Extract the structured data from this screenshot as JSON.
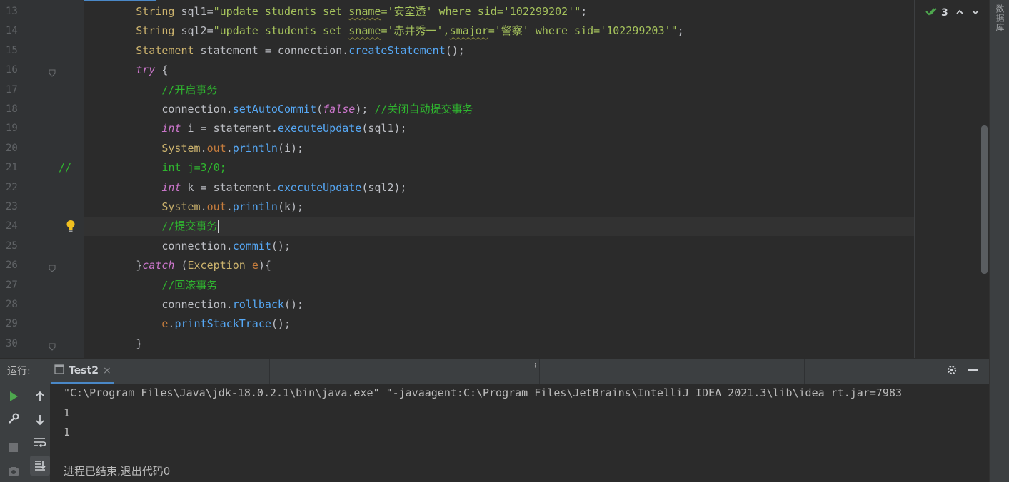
{
  "editor": {
    "lines": [
      {
        "n": "13",
        "tokens": [
          {
            "t": "        ",
            "c": "c-plain"
          },
          {
            "t": "String",
            "c": "c-type"
          },
          {
            "t": " sql1=",
            "c": "c-plain"
          },
          {
            "t": "\"update students set ",
            "c": "c-str"
          },
          {
            "t": "sname",
            "c": "c-str squiggle"
          },
          {
            "t": "='安室透' where sid='102299202'\"",
            "c": "c-str"
          },
          {
            "t": ";",
            "c": "c-plain"
          }
        ]
      },
      {
        "n": "14",
        "tokens": [
          {
            "t": "        ",
            "c": "c-plain"
          },
          {
            "t": "String",
            "c": "c-type"
          },
          {
            "t": " sql2=",
            "c": "c-plain"
          },
          {
            "t": "\"update students set ",
            "c": "c-str"
          },
          {
            "t": "sname",
            "c": "c-str squiggle"
          },
          {
            "t": "='赤井秀一',",
            "c": "c-str"
          },
          {
            "t": "smajor",
            "c": "c-str squiggle"
          },
          {
            "t": "='警察' where sid='102299203'\"",
            "c": "c-str"
          },
          {
            "t": ";",
            "c": "c-plain"
          }
        ]
      },
      {
        "n": "15",
        "tokens": [
          {
            "t": "        ",
            "c": "c-plain"
          },
          {
            "t": "Statement",
            "c": "c-type"
          },
          {
            "t": " statement = connection.",
            "c": "c-plain"
          },
          {
            "t": "createStatement",
            "c": "c-meth"
          },
          {
            "t": "();",
            "c": "c-plain"
          }
        ]
      },
      {
        "n": "16",
        "fold": true,
        "tokens": [
          {
            "t": "        ",
            "c": "c-plain"
          },
          {
            "t": "try",
            "c": "c-kw"
          },
          {
            "t": " {",
            "c": "c-plain"
          }
        ]
      },
      {
        "n": "17",
        "tokens": [
          {
            "t": "            ",
            "c": "c-plain"
          },
          {
            "t": "//开启事务",
            "c": "c-cm"
          }
        ]
      },
      {
        "n": "18",
        "tokens": [
          {
            "t": "            connection.",
            "c": "c-plain"
          },
          {
            "t": "setAutoCommit",
            "c": "c-meth"
          },
          {
            "t": "(",
            "c": "c-plain"
          },
          {
            "t": "false",
            "c": "c-kw"
          },
          {
            "t": "); ",
            "c": "c-plain"
          },
          {
            "t": "//关闭自动提交事务",
            "c": "c-cm"
          }
        ]
      },
      {
        "n": "19",
        "tokens": [
          {
            "t": "            ",
            "c": "c-plain"
          },
          {
            "t": "int",
            "c": "c-kw"
          },
          {
            "t": " i = statement.",
            "c": "c-plain"
          },
          {
            "t": "executeUpdate",
            "c": "c-meth"
          },
          {
            "t": "(sql1);",
            "c": "c-plain"
          }
        ]
      },
      {
        "n": "20",
        "tokens": [
          {
            "t": "            ",
            "c": "c-plain"
          },
          {
            "t": "System",
            "c": "c-type"
          },
          {
            "t": ".",
            "c": "c-plain"
          },
          {
            "t": "out",
            "c": "c-field"
          },
          {
            "t": ".",
            "c": "c-plain"
          },
          {
            "t": "println",
            "c": "c-meth"
          },
          {
            "t": "(i);",
            "c": "c-plain"
          }
        ]
      },
      {
        "n": "21",
        "tokens": [
          {
            "t": "//              int j=3/0;",
            "c": "c-cm",
            "shift": -36
          }
        ]
      },
      {
        "n": "22",
        "tokens": [
          {
            "t": "            ",
            "c": "c-plain"
          },
          {
            "t": "int",
            "c": "c-kw"
          },
          {
            "t": " k = statement.",
            "c": "c-plain"
          },
          {
            "t": "executeUpdate",
            "c": "c-meth"
          },
          {
            "t": "(sql2);",
            "c": "c-plain"
          }
        ]
      },
      {
        "n": "23",
        "tokens": [
          {
            "t": "            ",
            "c": "c-plain"
          },
          {
            "t": "System",
            "c": "c-type"
          },
          {
            "t": ".",
            "c": "c-plain"
          },
          {
            "t": "out",
            "c": "c-field"
          },
          {
            "t": ".",
            "c": "c-plain"
          },
          {
            "t": "println",
            "c": "c-meth"
          },
          {
            "t": "(k);",
            "c": "c-plain"
          }
        ]
      },
      {
        "n": "24",
        "current": true,
        "bulb": true,
        "tokens": [
          {
            "t": "            ",
            "c": "c-plain"
          },
          {
            "t": "//提交事务",
            "c": "c-cm"
          }
        ]
      },
      {
        "n": "25",
        "tokens": [
          {
            "t": "            connection.",
            "c": "c-plain"
          },
          {
            "t": "commit",
            "c": "c-meth"
          },
          {
            "t": "();",
            "c": "c-plain"
          }
        ]
      },
      {
        "n": "26",
        "fold": true,
        "tokens": [
          {
            "t": "        }",
            "c": "c-plain"
          },
          {
            "t": "catch",
            "c": "c-kw"
          },
          {
            "t": " (",
            "c": "c-plain"
          },
          {
            "t": "Exception",
            "c": "c-type"
          },
          {
            "t": " ",
            "c": "c-plain"
          },
          {
            "t": "e",
            "c": "c-field"
          },
          {
            "t": "){",
            "c": "c-plain"
          }
        ]
      },
      {
        "n": "27",
        "tokens": [
          {
            "t": "            ",
            "c": "c-plain"
          },
          {
            "t": "//回滚事务",
            "c": "c-cm"
          }
        ]
      },
      {
        "n": "28",
        "tokens": [
          {
            "t": "            connection.",
            "c": "c-plain"
          },
          {
            "t": "rollback",
            "c": "c-meth"
          },
          {
            "t": "();",
            "c": "c-plain"
          }
        ]
      },
      {
        "n": "29",
        "tokens": [
          {
            "t": "            ",
            "c": "c-plain"
          },
          {
            "t": "e",
            "c": "c-field"
          },
          {
            "t": ".",
            "c": "c-plain"
          },
          {
            "t": "printStackTrace",
            "c": "c-meth"
          },
          {
            "t": "();",
            "c": "c-plain"
          }
        ]
      },
      {
        "n": "30",
        "fold": true,
        "tokens": [
          {
            "t": "        }",
            "c": "c-plain"
          }
        ]
      }
    ],
    "inspection_count": "3"
  },
  "right_strip": {
    "label": "数据库"
  },
  "run_panel": {
    "label": "运行:",
    "tab_name": "Test2",
    "tab_close": "×",
    "separator_mark": "⁝"
  },
  "console": {
    "lines": [
      "\"C:\\Program Files\\Java\\jdk-18.0.2.1\\bin\\java.exe\" \"-javaagent:C:\\Program Files\\JetBrains\\IntelliJ IDEA 2021.3\\lib\\idea_rt.jar=7983",
      "1",
      "1",
      "",
      "进程已结束,退出代码0"
    ]
  },
  "icons": {
    "check": "double-check-icon",
    "up": "chevron-up-icon",
    "down": "chevron-down-icon",
    "gear": "gear-icon",
    "minimize": "minimize-icon",
    "run": "run-icon",
    "wrench": "wrench-icon",
    "stop": "stop-icon",
    "camera": "camera-icon",
    "arrow_up": "arrow-up-icon",
    "arrow_down": "arrow-down-icon",
    "wrap": "soft-wrap-icon",
    "scroll_end": "scroll-to-end-icon"
  },
  "colors": {
    "accent": "#4a88c7",
    "editor_bg": "#2b2b2b",
    "panel_bg": "#3c3f41"
  }
}
